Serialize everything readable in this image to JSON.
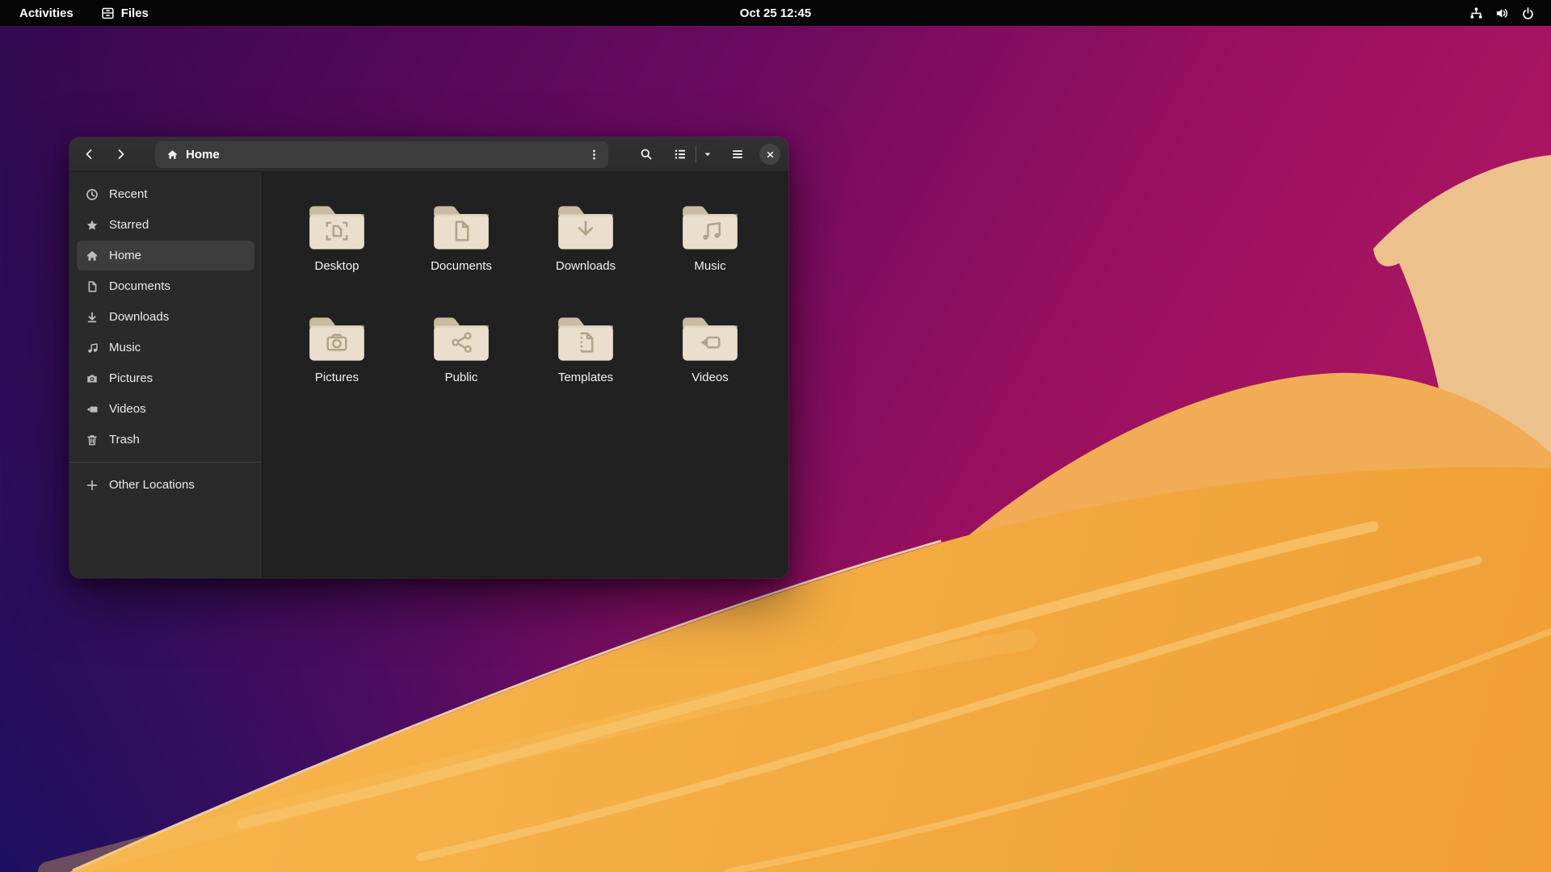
{
  "top_bar": {
    "activities_label": "Activities",
    "focused_app": {
      "name": "Files",
      "icon": "files-app-icon"
    },
    "clock": "Oct 25 12:45",
    "status_icons": [
      "network-wired-icon",
      "volume-icon",
      "power-icon"
    ]
  },
  "window": {
    "header": {
      "location_title": "Home",
      "icons": {
        "back": "back-arrow-icon",
        "forward": "forward-arrow-icon",
        "location": "home-icon",
        "path_menu": "three-dot-menu-icon",
        "search": "search-icon",
        "view_toggle": "list-view-icon",
        "view_options": "caret-down-icon",
        "app_menu": "hamburger-menu-icon",
        "close": "close-icon"
      }
    },
    "sidebar": {
      "items": [
        {
          "label": "Recent",
          "icon": "clock",
          "selected": false
        },
        {
          "label": "Starred",
          "icon": "star",
          "selected": false
        },
        {
          "label": "Home",
          "icon": "home",
          "selected": true
        },
        {
          "label": "Documents",
          "icon": "document",
          "selected": false
        },
        {
          "label": "Downloads",
          "icon": "download",
          "selected": false
        },
        {
          "label": "Music",
          "icon": "music",
          "selected": false
        },
        {
          "label": "Pictures",
          "icon": "camera",
          "selected": false
        },
        {
          "label": "Videos",
          "icon": "video",
          "selected": false
        },
        {
          "label": "Trash",
          "icon": "trash",
          "selected": false
        }
      ],
      "other_locations": {
        "label": "Other Locations",
        "icon": "plus"
      }
    },
    "content": {
      "folders": [
        {
          "name": "Desktop",
          "emblem": "desktop"
        },
        {
          "name": "Documents",
          "emblem": "document"
        },
        {
          "name": "Downloads",
          "emblem": "download"
        },
        {
          "name": "Music",
          "emblem": "music"
        },
        {
          "name": "Pictures",
          "emblem": "camera"
        },
        {
          "name": "Public",
          "emblem": "share"
        },
        {
          "name": "Templates",
          "emblem": "template"
        },
        {
          "name": "Videos",
          "emblem": "video"
        }
      ]
    }
  },
  "colors": {
    "topbar_bg": "#060606",
    "headerbar_bg": "#2e2e2e",
    "pathbar_bg": "#3c3c3c",
    "sidebar_bg": "#2a2a2a",
    "sidebar_selected": "#3d3d3d",
    "content_bg": "#212121",
    "folder_body": "#e9dfcc",
    "folder_tab": "#c9bba2",
    "folder_emblem": "#b1a289",
    "wallpaper_purple_dark": "#35084d",
    "wallpaper_magenta": "#a01261",
    "wallpaper_indigo": "#1d1060",
    "wallpaper_dune_orange": "#f5ad41",
    "wallpaper_dune_tan": "#edc18c"
  }
}
